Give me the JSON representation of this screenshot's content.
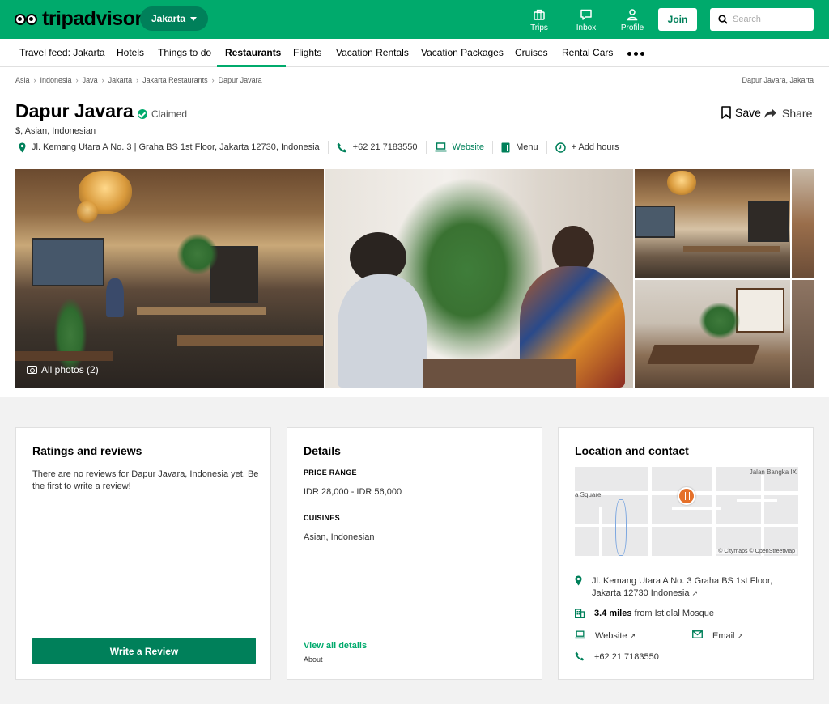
{
  "header": {
    "logo_text": "tripadvisor",
    "logo_tm": "®",
    "geo": "Jakarta",
    "nav": [
      {
        "label": "Trips",
        "icon": "briefcase-icon"
      },
      {
        "label": "Inbox",
        "icon": "chat-icon"
      },
      {
        "label": "Profile",
        "icon": "person-icon"
      }
    ],
    "join_label": "Join",
    "search_placeholder": "Search"
  },
  "subnav": {
    "items": [
      "Travel feed: Jakarta",
      "Hotels",
      "Things to do",
      "Restaurants",
      "Flights",
      "Vacation Rentals",
      "Vacation Packages",
      "Cruises",
      "Rental Cars"
    ],
    "active": "Restaurants"
  },
  "breadcrumb": {
    "items": [
      "Asia",
      "Indonesia",
      "Java",
      "Jakarta",
      "Jakarta Restaurants",
      "Dapur Javara"
    ],
    "right": "Dapur Javara, Jakarta"
  },
  "restaurant": {
    "name": "Dapur Javara",
    "claimed": "Claimed",
    "cuisine_line": "$, Asian, Indonesian",
    "save_label": "Save",
    "share_label": "Share",
    "address": "Jl. Kemang Utara A No. 3 | Graha BS 1st Floor, Jakarta 12730, Indonesia",
    "phone": "+62 21 7183550",
    "website": "Website",
    "menu": "Menu",
    "hours": "+ Add hours"
  },
  "photos": {
    "all_photos_label": "All photos (2)"
  },
  "ratings": {
    "title": "Ratings and reviews",
    "no_reviews": "There are no reviews for Dapur Javara, Indonesia yet. Be the first to write a review!",
    "write_label": "Write a Review"
  },
  "details": {
    "title": "Details",
    "price_label": "PRICE RANGE",
    "price_value": "IDR 28,000 - IDR 56,000",
    "cuisines_label": "CUISINES",
    "cuisines_value": "Asian, Indonesian",
    "view_all": "View all details",
    "about": "About"
  },
  "location": {
    "title": "Location and contact",
    "map_labels": [
      "Jalan Bangka IX",
      "a Square"
    ],
    "map_attribution": "© Citymaps © OpenStreetMap",
    "address": "Jl. Kemang Utara A No. 3 Graha BS 1st Floor, Jakarta 12730 Indonesia",
    "distance_bold": "3.4 miles",
    "distance_rest": " from Istiqlal Mosque",
    "website": "Website",
    "email": "Email",
    "phone": "+62 21 7183550"
  },
  "colors": {
    "brand": "#00aa6c",
    "brand_dark": "#00805a",
    "pin": "#e5702a"
  }
}
